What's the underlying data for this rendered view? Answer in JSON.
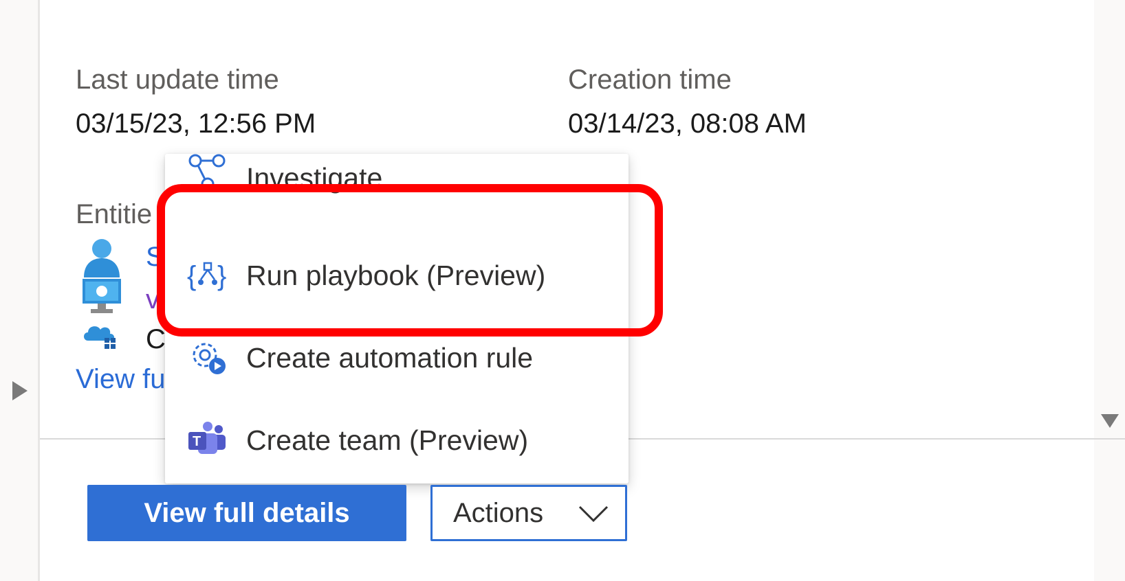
{
  "details": {
    "last_update_label": "Last update time",
    "last_update_value": "03/15/23, 12:56 PM",
    "creation_label": "Creation time",
    "creation_value": "03/14/23, 08:08 AM",
    "entities_label": "Entitie",
    "entity_1_text": "S",
    "entity_2_text": "v",
    "entity_3_text": "C",
    "view_full_link_partial": "View fu"
  },
  "menu": {
    "items": [
      {
        "label": "Investigate",
        "icon": "investigate-graph-icon"
      },
      {
        "label": "Run playbook (Preview)",
        "icon": "playbook-icon"
      },
      {
        "label": "Create automation rule",
        "icon": "automation-gear-icon"
      },
      {
        "label": "Create team (Preview)",
        "icon": "teams-icon"
      }
    ]
  },
  "footer": {
    "view_full_details": "View full details",
    "actions": "Actions"
  },
  "colors": {
    "primary": "#2f6fd4",
    "highlight": "#ff0000",
    "link": "#2a6bd6"
  }
}
